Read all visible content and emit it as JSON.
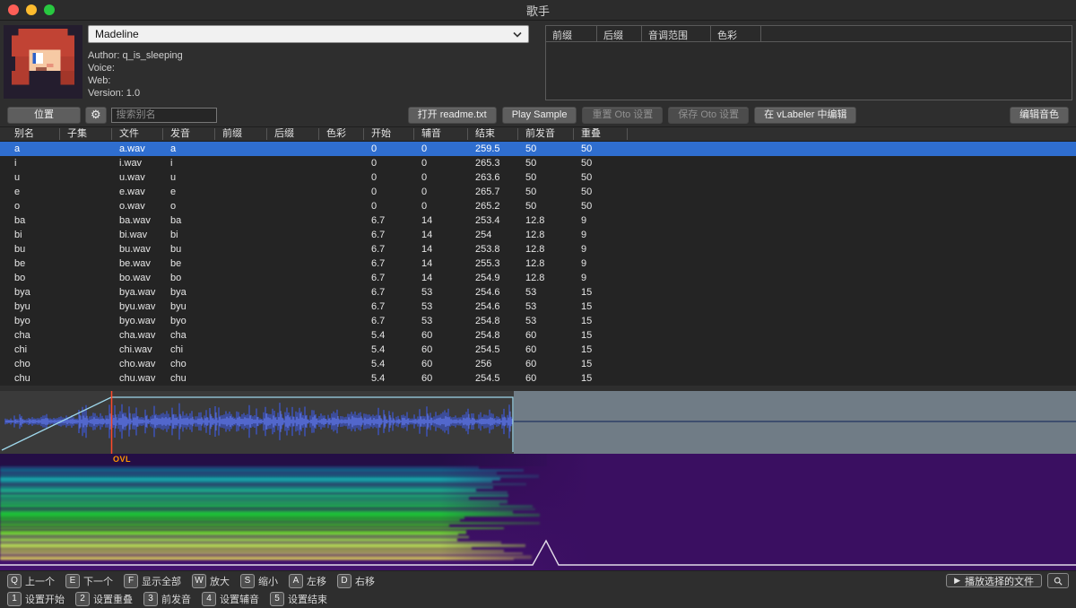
{
  "window": {
    "title": "歌手"
  },
  "singer": {
    "name": "Madeline",
    "author": "Author: q_is_sleeping",
    "voice": "Voice:",
    "web": "Web:",
    "version": "Version: 1.0"
  },
  "subbank_panel": {
    "headers": [
      "前缀",
      "后缀",
      "音调范围",
      "色彩"
    ]
  },
  "toolbar": {
    "location": "位置",
    "search_placeholder": "搜索别名",
    "open_readme": "打开 readme.txt",
    "play_sample": "Play Sample",
    "reset_oto": "重置 Oto 设置",
    "save_oto": "保存 Oto 设置",
    "edit_vlabeler": "在 vLabeler 中编辑",
    "edit_color": "编辑音色"
  },
  "oto_table": {
    "headers": [
      "别名",
      "子集",
      "文件",
      "发音",
      "前缀",
      "后缀",
      "色彩",
      "开始",
      "辅音",
      "结束",
      "前发音",
      "重叠"
    ],
    "selected_index": 0,
    "rows": [
      [
        "a",
        "",
        "a.wav",
        "a",
        "",
        "",
        "",
        "0",
        "0",
        "259.5",
        "50",
        "50"
      ],
      [
        "i",
        "",
        "i.wav",
        "i",
        "",
        "",
        "",
        "0",
        "0",
        "265.3",
        "50",
        "50"
      ],
      [
        "u",
        "",
        "u.wav",
        "u",
        "",
        "",
        "",
        "0",
        "0",
        "263.6",
        "50",
        "50"
      ],
      [
        "e",
        "",
        "e.wav",
        "e",
        "",
        "",
        "",
        "0",
        "0",
        "265.7",
        "50",
        "50"
      ],
      [
        "o",
        "",
        "o.wav",
        "o",
        "",
        "",
        "",
        "0",
        "0",
        "265.2",
        "50",
        "50"
      ],
      [
        "ba",
        "",
        "ba.wav",
        "ba",
        "",
        "",
        "",
        "6.7",
        "14",
        "253.4",
        "12.8",
        "9"
      ],
      [
        "bi",
        "",
        "bi.wav",
        "bi",
        "",
        "",
        "",
        "6.7",
        "14",
        "254",
        "12.8",
        "9"
      ],
      [
        "bu",
        "",
        "bu.wav",
        "bu",
        "",
        "",
        "",
        "6.7",
        "14",
        "253.8",
        "12.8",
        "9"
      ],
      [
        "be",
        "",
        "be.wav",
        "be",
        "",
        "",
        "",
        "6.7",
        "14",
        "255.3",
        "12.8",
        "9"
      ],
      [
        "bo",
        "",
        "bo.wav",
        "bo",
        "",
        "",
        "",
        "6.7",
        "14",
        "254.9",
        "12.8",
        "9"
      ],
      [
        "bya",
        "",
        "bya.wav",
        "bya",
        "",
        "",
        "",
        "6.7",
        "53",
        "254.6",
        "53",
        "15"
      ],
      [
        "byu",
        "",
        "byu.wav",
        "byu",
        "",
        "",
        "",
        "6.7",
        "53",
        "254.6",
        "53",
        "15"
      ],
      [
        "byo",
        "",
        "byo.wav",
        "byo",
        "",
        "",
        "",
        "6.7",
        "53",
        "254.8",
        "53",
        "15"
      ],
      [
        "cha",
        "",
        "cha.wav",
        "cha",
        "",
        "",
        "",
        "5.4",
        "60",
        "254.8",
        "60",
        "15"
      ],
      [
        "chi",
        "",
        "chi.wav",
        "chi",
        "",
        "",
        "",
        "5.4",
        "60",
        "254.5",
        "60",
        "15"
      ],
      [
        "cho",
        "",
        "cho.wav",
        "cho",
        "",
        "",
        "",
        "5.4",
        "60",
        "256",
        "60",
        "15"
      ],
      [
        "chu",
        "",
        "chu.wav",
        "chu",
        "",
        "",
        "",
        "5.4",
        "60",
        "254.5",
        "60",
        "15"
      ]
    ]
  },
  "editor": {
    "overlap_label": "OVL"
  },
  "shortcuts": {
    "row1": [
      {
        "key": "Q",
        "label": "上一个"
      },
      {
        "key": "E",
        "label": "下一个"
      },
      {
        "key": "F",
        "label": "显示全部"
      },
      {
        "key": "W",
        "label": "放大"
      },
      {
        "key": "S",
        "label": "缩小"
      },
      {
        "key": "A",
        "label": "左移"
      },
      {
        "key": "D",
        "label": "右移"
      }
    ],
    "row2": [
      {
        "key": "1",
        "label": "设置开始"
      },
      {
        "key": "2",
        "label": "设置重叠"
      },
      {
        "key": "3",
        "label": "前发音"
      },
      {
        "key": "4",
        "label": "设置辅音"
      },
      {
        "key": "5",
        "label": "设置结束"
      }
    ],
    "play_selected": "播放选择的文件"
  },
  "colors": {
    "selection_blue": "#2f6ecf",
    "waveform_blue": "#3d55c8",
    "envelope_cyan": "#9fd8ec",
    "marker_red": "#ff4a2a",
    "overlap_label_orange": "#ff9800",
    "spectrogram_purple": "#3a0f61",
    "cutoff_overlay": "#a6bdd1"
  }
}
